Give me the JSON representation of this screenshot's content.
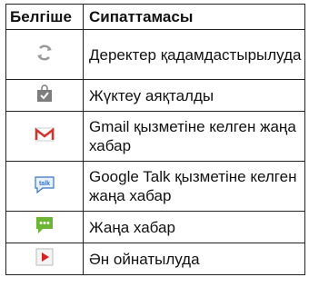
{
  "table": {
    "headers": [
      "Белгіше",
      "Сипаттамасы"
    ],
    "rows": [
      {
        "icon": "sync-arrows-icon",
        "description": "Деректер қадамдастырылуда"
      },
      {
        "icon": "download-complete-bag-icon",
        "description": "Жүктеу аяқталды"
      },
      {
        "icon": "gmail-icon",
        "description": "Gmail қызметіне келген жаңа хабар"
      },
      {
        "icon": "google-talk-icon",
        "description": "Google Talk қызметіне келген жаңа хабар"
      },
      {
        "icon": "new-message-icon",
        "description": "Жаңа хабар"
      },
      {
        "icon": "music-playing-icon",
        "description": "Ән ойнатылуда"
      }
    ]
  },
  "colors": {
    "border": "#222222",
    "sync_icon": "#9a9a9a",
    "bag_icon": "#7d7d7d",
    "gmail_red": "#d9302b",
    "talk_blue": "#3a74c4",
    "message_green": "#6ab531",
    "play_red": "#d82020"
  }
}
